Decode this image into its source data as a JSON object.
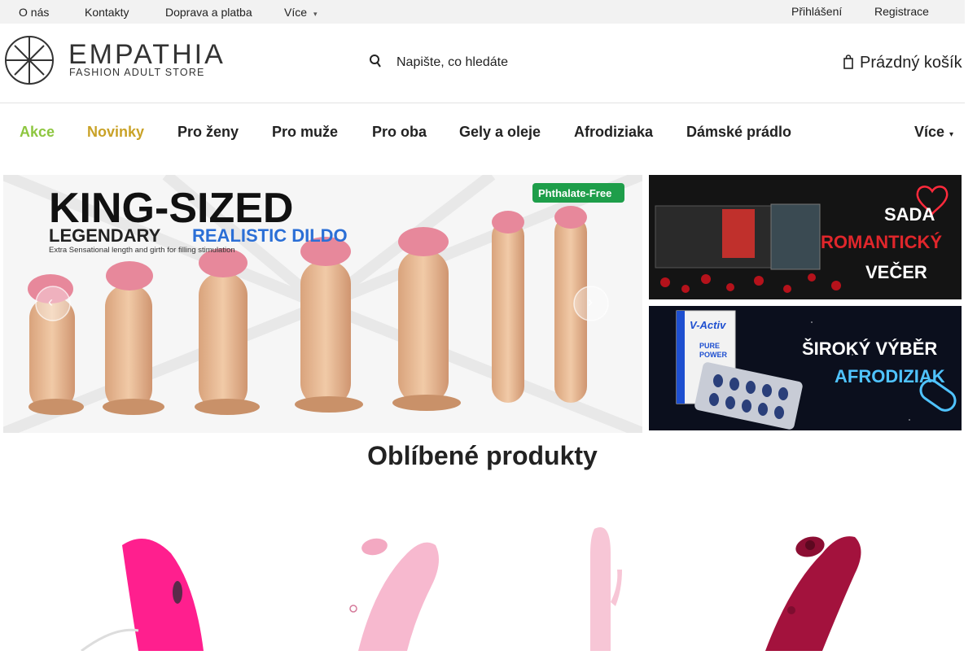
{
  "topbar": {
    "links": [
      "O nás",
      "Kontakty",
      "Doprava a platba",
      "Více"
    ],
    "login": "Přihlášení",
    "register": "Registrace"
  },
  "logo": {
    "name": "EMPATHIA",
    "tagline": "FASHION ADULT STORE"
  },
  "search": {
    "placeholder": "Napište, co hledáte"
  },
  "cart": {
    "label": "Prázdný košík"
  },
  "nav": {
    "items": [
      {
        "label": "Akce",
        "color": "#8dc63f"
      },
      {
        "label": "Novinky",
        "color": "#c9a227"
      },
      {
        "label": "Pro ženy",
        "color": "#222222"
      },
      {
        "label": "Pro muže",
        "color": "#222222"
      },
      {
        "label": "Pro oba",
        "color": "#222222"
      },
      {
        "label": "Gely a oleje",
        "color": "#222222"
      },
      {
        "label": "Afrodiziaka",
        "color": "#222222"
      },
      {
        "label": "Dámské prádlo",
        "color": "#222222"
      }
    ],
    "more": "Více"
  },
  "banners": {
    "main": {
      "headline": "KING-SIZED",
      "sub1": "LEGENDARY",
      "sub2": "REALISTIC DILDO",
      "small": "Extra Sensational length and girth for filling stimulation",
      "badge": "Phthalate-Free"
    },
    "side1": {
      "line1": "SADA",
      "line2": "ROMANTICKÝ",
      "line3": "VEČER"
    },
    "side2": {
      "line1": "ŠIROKÝ VÝBĚR",
      "line2": "AFRODIZIAK",
      "brand": "V-Activ",
      "box1": "PURE",
      "box2": "POWER"
    }
  },
  "section": {
    "title": "Oblíbené produkty"
  },
  "colors": {
    "accent_green": "#8dc63f",
    "accent_gold": "#c9a227",
    "banner_red": "#e0262b",
    "banner_blue": "#4fc3ff"
  }
}
